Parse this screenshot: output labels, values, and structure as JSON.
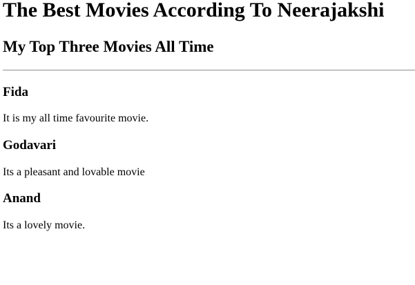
{
  "page": {
    "title": "The Best Movies According To Neerajakshi",
    "subtitle": "My Top Three Movies All Time"
  },
  "movies": [
    {
      "name": "Fida",
      "description": "It is my all time favourite movie."
    },
    {
      "name": "Godavari",
      "description": "Its a pleasant and lovable movie"
    },
    {
      "name": "Anand",
      "description": "Its a lovely movie."
    }
  ]
}
